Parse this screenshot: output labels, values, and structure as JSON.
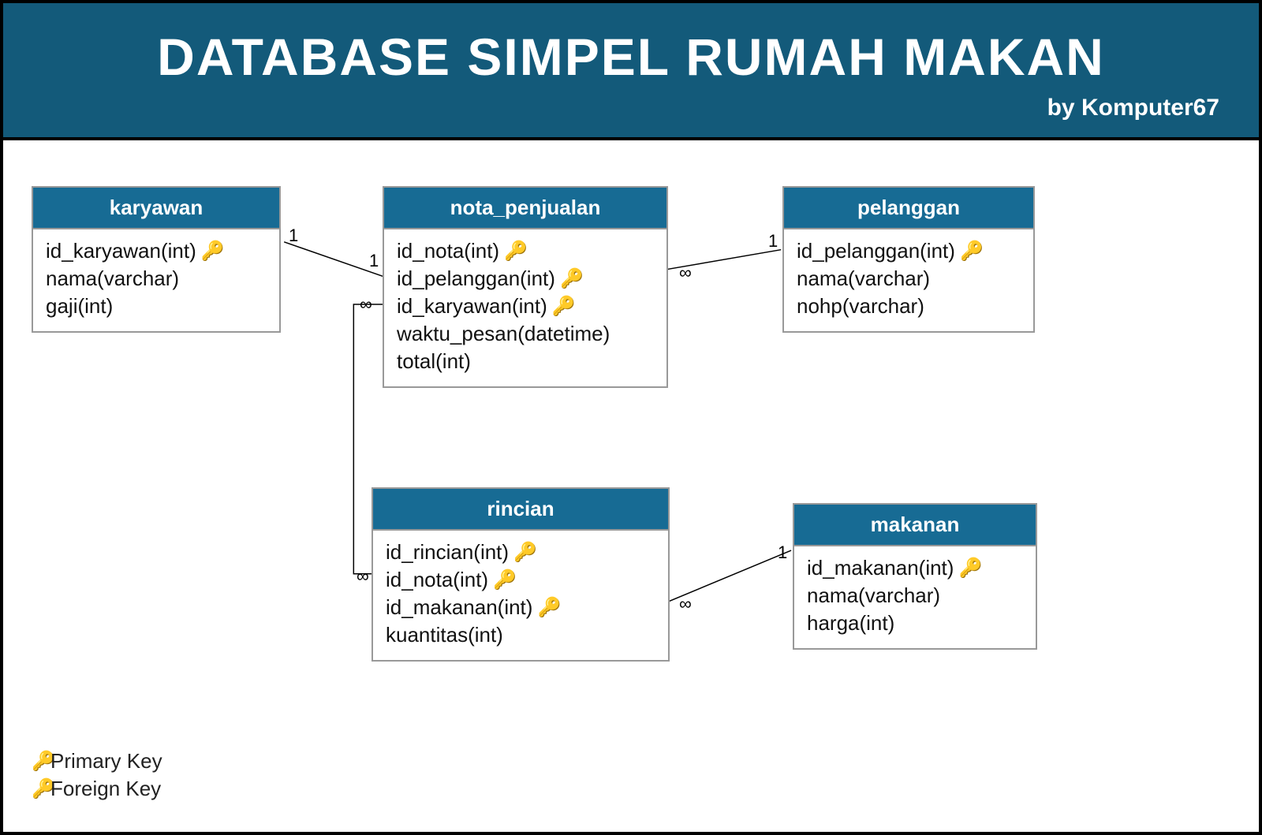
{
  "header": {
    "title": "DATABASE SIMPEL RUMAH MAKAN",
    "author": "by Komputer67"
  },
  "entities": {
    "karyawan": {
      "name": "karyawan",
      "fields": [
        {
          "text": "id_karyawan(int)",
          "key": "pk"
        },
        {
          "text": "nama(varchar)",
          "key": null
        },
        {
          "text": "gaji(int)",
          "key": null
        }
      ]
    },
    "nota_penjualan": {
      "name": "nota_penjualan",
      "fields": [
        {
          "text": "id_nota(int)",
          "key": "pk"
        },
        {
          "text": "id_pelanggan(int)",
          "key": "fk"
        },
        {
          "text": "id_karyawan(int)",
          "key": "fk"
        },
        {
          "text": "waktu_pesan(datetime)",
          "key": null
        },
        {
          "text": "total(int)",
          "key": null
        }
      ]
    },
    "pelanggan": {
      "name": "pelanggan",
      "fields": [
        {
          "text": "id_pelanggan(int)",
          "key": "pk"
        },
        {
          "text": "nama(varchar)",
          "key": null
        },
        {
          "text": "nohp(varchar)",
          "key": null
        }
      ]
    },
    "rincian": {
      "name": "rincian",
      "fields": [
        {
          "text": "id_rincian(int)",
          "key": "pk"
        },
        {
          "text": "id_nota(int)",
          "key": "fk"
        },
        {
          "text": "id_makanan(int)",
          "key": "fk"
        },
        {
          "text": "kuantitas(int)",
          "key": null
        }
      ]
    },
    "makanan": {
      "name": "makanan",
      "fields": [
        {
          "text": "id_makanan(int)",
          "key": "pk"
        },
        {
          "text": "nama(varchar)",
          "key": null
        },
        {
          "text": "harga(int)",
          "key": null
        }
      ]
    }
  },
  "legend": {
    "pk": "Primary Key",
    "fk": "Foreign Key"
  },
  "relationships": {
    "karyawan_nota": {
      "left": "1",
      "right": "1"
    },
    "nota_pelanggan": {
      "left": "∞",
      "right": "1"
    },
    "nota_rincian": {
      "left": "∞",
      "right": "∞"
    },
    "rincian_makanan": {
      "left": "∞",
      "right": "1"
    }
  },
  "colors": {
    "header_bg": "#135a7a",
    "entity_header_bg": "#176b94",
    "pk": "#e0b400",
    "fk": "#a8a8a8"
  }
}
